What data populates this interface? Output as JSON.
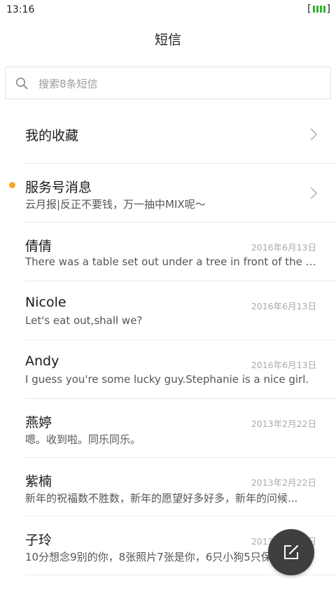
{
  "status_bar": {
    "time": "13:16",
    "battery_open": "[",
    "battery_close": "]"
  },
  "header": {
    "title": "短信"
  },
  "search": {
    "placeholder": "搜索8条短信"
  },
  "favorites": {
    "label": "我的收藏"
  },
  "service": {
    "name": "服务号消息",
    "preview": "云月报|反正不要钱，万一抽中MIX呢～"
  },
  "conversations": [
    {
      "name": "倩倩",
      "date": "2016年6月13日",
      "preview": "There was a table set out under a tree in front of the ho..."
    },
    {
      "name": "Nicole",
      "date": "2016年6月13日",
      "preview": "Let's eat out,shall we?"
    },
    {
      "name": "Andy",
      "date": "2016年6月13日",
      "preview": "I guess you're some lucky guy.Stephanie is a nice girl."
    },
    {
      "name": "燕婷",
      "date": "2013年2月22日",
      "preview": "嗯。收到啦。同乐同乐。"
    },
    {
      "name": "紫楠",
      "date": "2013年2月22日",
      "preview": "新年的祝福数不胜数，新年的愿望好多好多，新年的问候..."
    },
    {
      "name": "子玲",
      "date": "2013年2月22日",
      "preview": "10分想念9别的你，8张照片7张是你，6只小狗5只保护你"
    }
  ],
  "colors": {
    "unread_dot": "#f5a623",
    "battery": "#2fb52f",
    "fab": "#3e3e3e"
  },
  "icons": {
    "search": "search-icon",
    "chevron": "chevron-right-icon",
    "compose": "compose-icon"
  }
}
